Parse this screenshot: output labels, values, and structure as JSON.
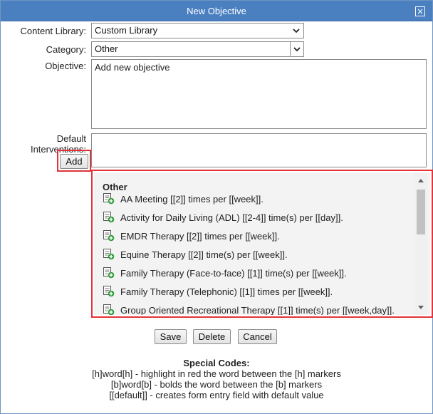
{
  "dialog": {
    "title": "New Objective",
    "close_glyph": "×"
  },
  "form": {
    "content_library_label": "Content Library:",
    "content_library_value": "Custom Library",
    "category_label": "Category:",
    "category_value": "Other",
    "objective_label": "Objective:",
    "objective_value": "Add new objective",
    "default_interventions_label_line1": "Default",
    "default_interventions_label_line2": "Interventions:",
    "default_interventions_value": "",
    "add_button": "Add"
  },
  "intervention_list": {
    "heading": "Other",
    "item_icon": "add-document-icon",
    "items": [
      "AA Meeting [[2]] times per [[week]].",
      "Activity for Daily Living (ADL) [[2-4]] time(s) per [[day]].",
      "EMDR Therapy [[2]] times per [[week]].",
      "Equine Therapy [[2]] time(s) per [[week]].",
      "Family Therapy (Face-to-face) [[1]] time(s) per [[week]].",
      "Family Therapy (Telephonic) [[1]] times per [[week]].",
      "Group Oriented Recreational Therapy [[1]] time(s) per [[week,day]]."
    ]
  },
  "actions": {
    "save": "Save",
    "delete": "Delete",
    "cancel": "Cancel"
  },
  "special_codes": {
    "heading": "Special Codes:",
    "lines": [
      "[h]word[h] - highlight in red the word between the [h] markers",
      "[b]word[b] - bolds the word between the [b] markers",
      "[[default]] - creates form entry field with default value"
    ]
  },
  "colors": {
    "titlebar": "#4a7fc0",
    "highlight_border": "#e2333a",
    "icon_green": "#2e9a3a"
  }
}
